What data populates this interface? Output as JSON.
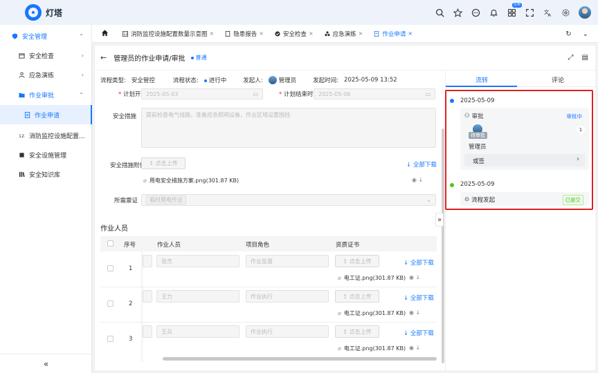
{
  "app": {
    "name": "灯塔"
  },
  "top_icons": [
    "search-icon",
    "star-icon",
    "message-icon",
    "bell-icon",
    "grid-icon",
    "fullscreen-icon",
    "translate-icon",
    "gear-icon",
    "avatar"
  ],
  "top_badge": "应用",
  "sidebar": {
    "items": [
      {
        "label": "安全管理",
        "icon": "shield-icon",
        "expanded": true
      },
      {
        "label": "安全检查",
        "icon": "calendar-icon"
      },
      {
        "label": "应急演练",
        "icon": "user-icon"
      },
      {
        "label": "作业审批",
        "icon": "folder-icon",
        "expanded": true
      },
      {
        "label": "作业申请",
        "icon": "doc-icon",
        "active": true
      },
      {
        "label": "消防监控设施配置...",
        "icon": "number-icon"
      },
      {
        "label": "安全设施管理",
        "icon": "square-icon"
      },
      {
        "label": "安全知识库",
        "icon": "books-icon"
      }
    ],
    "collapse_label": "«"
  },
  "tabs": [
    {
      "label": "消防监控设施配置数量示意图"
    },
    {
      "label": "隐患报告"
    },
    {
      "label": "安全检查"
    },
    {
      "label": "应急演练"
    },
    {
      "label": "作业申请",
      "active": true
    }
  ],
  "page": {
    "title": "管理员的作业申请/审批",
    "level": "普通"
  },
  "info": {
    "flow_type_label": "流程类型:",
    "flow_type": "安全管控",
    "flow_status_label": "流程状态:",
    "flow_status": "进行中",
    "initiator_label": "发起人:",
    "initiator": "管理员",
    "time_label": "发起时间:",
    "time": "2025-05-09 13:52"
  },
  "form": {
    "start_label": "计划开始时间",
    "start_value": "2025-05-03",
    "end_label": "计划结束时间",
    "end_value": "2025-05-06",
    "measures_label": "安全措施",
    "measures_value": "提前检查电气线路，准备应急照明设备，作业区域设置围挡",
    "attachment_label": "安全措施附件",
    "upload_label": "↥ 点击上传",
    "download_all": "全部下载",
    "attachment_file": "用电安全措施方案.png(301.87 KB)",
    "license_label": "所需票证",
    "license_value": "临时用电作业"
  },
  "workers": {
    "section_title": "作业人员",
    "headers": {
      "seq": "序号",
      "person": "作业人员",
      "role": "项目角色",
      "cert": "资质证书"
    },
    "rows": [
      {
        "seq": "1",
        "person": "张杰",
        "role": "作业监督",
        "file": "电工证.png(301.87 KB)"
      },
      {
        "seq": "2",
        "person": "王力",
        "role": "作业执行",
        "file": "电工证.png(301.87 KB)"
      },
      {
        "seq": "3",
        "person": "王兵",
        "role": "作业执行",
        "file": "电工证.png(301.87 KB)"
      }
    ],
    "upload_label": "↥ 点击上传",
    "download_all": "全部下载"
  },
  "right_panel": {
    "tabs": [
      "流转",
      "评论"
    ],
    "timeline": [
      {
        "date": "2025-05-09",
        "title": "审批",
        "status": "审批中",
        "count": "1",
        "pending_tag": "待审批",
        "approver": "管理员",
        "sign_mode": "或签"
      },
      {
        "date": "2025-05-09",
        "title": "流程发起",
        "status": "已提交"
      }
    ]
  },
  "colors": {
    "primary": "#1677ff",
    "highlight": "#e02020",
    "success": "#52c41a"
  }
}
